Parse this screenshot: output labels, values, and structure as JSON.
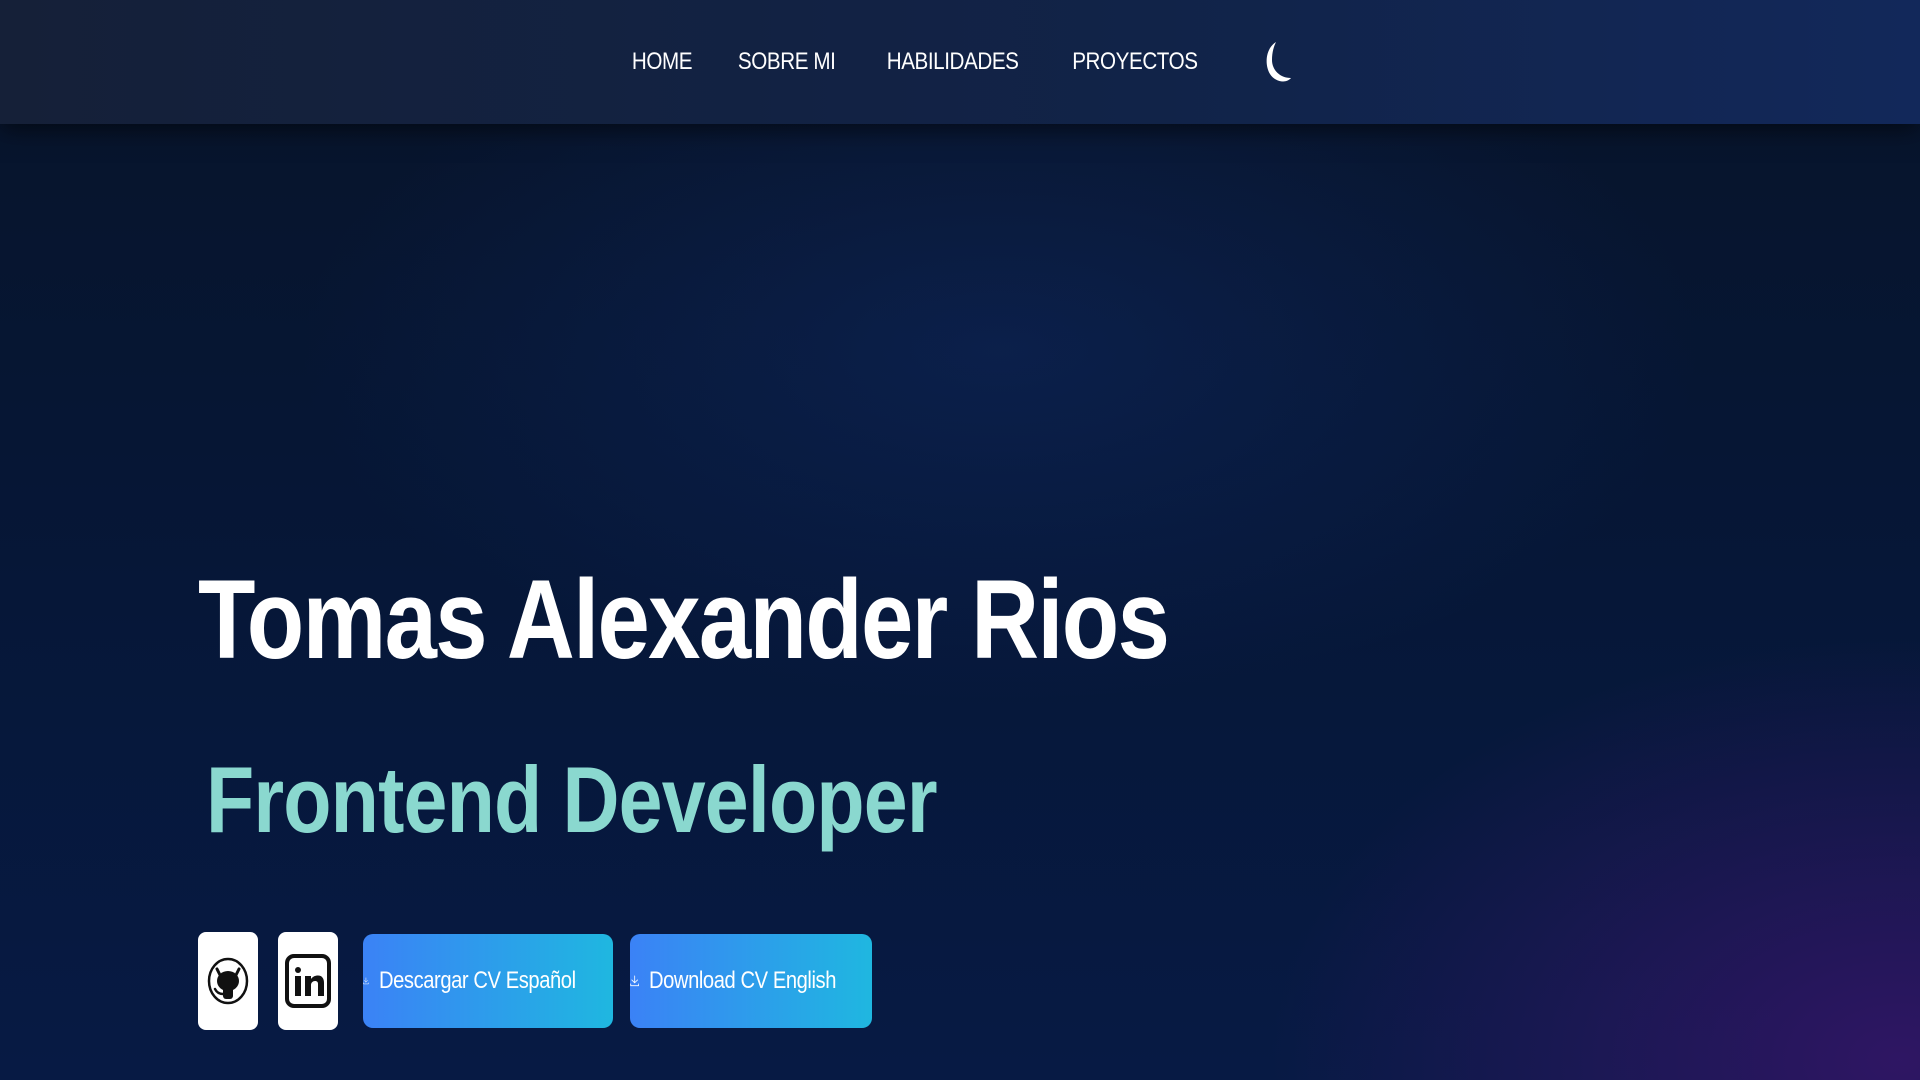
{
  "nav": {
    "items": [
      {
        "label": "HOME"
      },
      {
        "label": "SOBRE MI"
      },
      {
        "label": "HABILIDADES"
      },
      {
        "label": "PROYECTOS"
      }
    ],
    "theme_icon": "moon-icon"
  },
  "hero": {
    "name": "Tomas Alexander Rios",
    "role": "Frontend Developer"
  },
  "actions": {
    "github_icon": "github-icon",
    "linkedin_icon": "linkedin-icon",
    "cv_es_label": "Descargar CV Español",
    "cv_en_label": "Download CV English",
    "download_icon": "download-icon"
  },
  "colors": {
    "role_accent": "#8ad8cf",
    "button_gradient_start": "#3b82f6",
    "button_gradient_end": "#1fb7e0",
    "background": "#061634"
  }
}
